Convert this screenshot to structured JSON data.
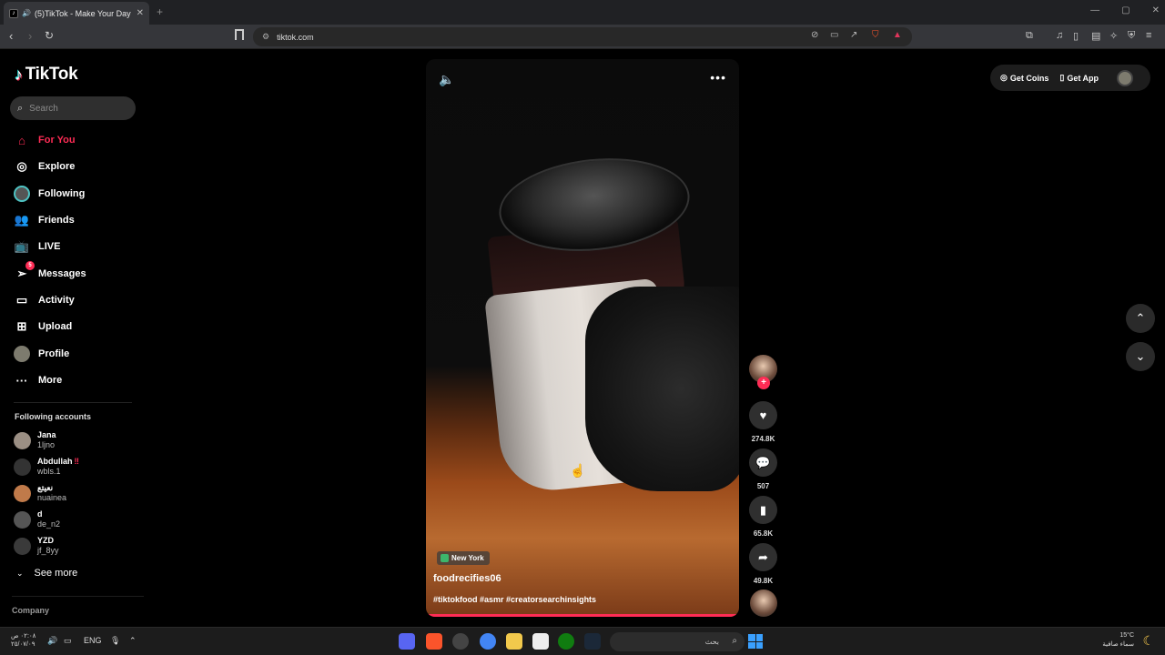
{
  "browser": {
    "tab_title": "(5)TikTok - Make Your Day",
    "new_tab": "+",
    "url": "tiktok.com"
  },
  "sidebar": {
    "brand": "TikTok",
    "search_placeholder": "Search",
    "nav": [
      {
        "label": "For You",
        "icon": "home-icon",
        "active": true
      },
      {
        "label": "Explore",
        "icon": "compass-icon"
      },
      {
        "label": "Following",
        "icon": "following-avatar-icon"
      },
      {
        "label": "Friends",
        "icon": "friends-icon"
      },
      {
        "label": "LIVE",
        "icon": "live-icon"
      },
      {
        "label": "Messages",
        "icon": "messages-icon",
        "badge": "5"
      },
      {
        "label": "Activity",
        "icon": "activity-icon"
      },
      {
        "label": "Upload",
        "icon": "upload-icon"
      },
      {
        "label": "Profile",
        "icon": "profile-avatar-icon"
      },
      {
        "label": "More",
        "icon": "more-icon"
      }
    ],
    "following_title": "Following accounts",
    "accounts": [
      {
        "name": "Jana",
        "handle": "1ljno"
      },
      {
        "name": "Abdullah",
        "flag": "‼",
        "handle": "wbls.1"
      },
      {
        "name": "نعيتع",
        "handle": "nuainea"
      },
      {
        "name": "d",
        "handle": "de_n2"
      },
      {
        "name": "YZD",
        "handle": "jf_8yy"
      }
    ],
    "see_more": "See more",
    "company": "Company"
  },
  "video": {
    "location": "New York",
    "author": "foodrecifies06",
    "hashtags": "#tiktokfood #asmr #creatorsearchinsights",
    "progress": 1.0
  },
  "actions": {
    "likes": "274.8K",
    "comments": "507",
    "saves": "65.8K",
    "shares": "49.8K"
  },
  "top_right": {
    "get_coins": "Get Coins",
    "get_app": "Get App"
  },
  "taskbar": {
    "time": "٠٢:٠٨ ص",
    "date": "٢٥/٠٧/٠٩",
    "language": "ENG",
    "search_text": "بحث",
    "temperature": "15°C",
    "weather": "سماء صافية"
  },
  "colors": {
    "accent": "#fe2c55",
    "teal": "#25f4ee"
  }
}
